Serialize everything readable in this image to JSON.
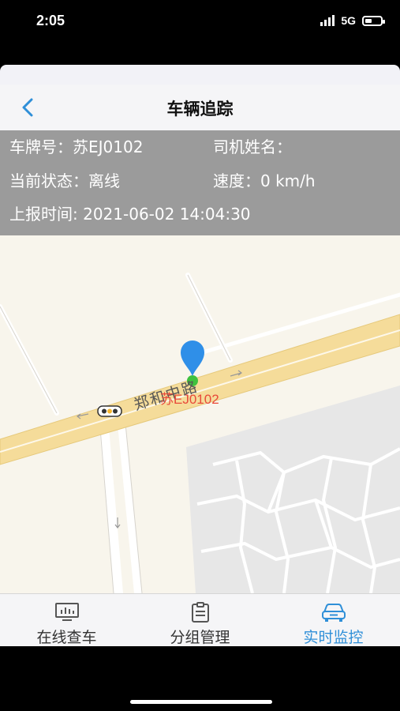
{
  "status": {
    "time": "2:05",
    "network": "5G",
    "icons": [
      "signal-icon",
      "battery-icon"
    ]
  },
  "nav": {
    "title": "车辆追踪",
    "back_icon": "chevron-left-icon"
  },
  "info": {
    "plate_label": "车牌号：",
    "plate_value": "苏EJ0102",
    "driver_label": "司机姓名：",
    "driver_value": "",
    "state_label": "当前状态：",
    "state_value": "离线",
    "speed_label": "速度：",
    "speed_value": "0 km/h",
    "report_label": "上报时间: ",
    "report_value": "2021-06-02 14:04:30"
  },
  "map": {
    "road_name": "郑和中路",
    "vehicle_plate": "苏EJ0102",
    "marker_icon": "location-pin-icon",
    "traffic_light_icon": "traffic-light-icon",
    "colors": {
      "background": "#f8f5ec",
      "main_road": "#f5dc9a",
      "block": "#e6e6e6",
      "marker": "#2f8fe8",
      "vehicle_dot": "#3ec13e",
      "label": "#e84a3a"
    }
  },
  "tabs": [
    {
      "label": "在线查车",
      "icon": "monitor-chart-icon",
      "active": false
    },
    {
      "label": "分组管理",
      "icon": "clipboard-icon",
      "active": false
    },
    {
      "label": "实时监控",
      "icon": "car-icon",
      "active": true
    }
  ],
  "colors": {
    "accent": "#2f8fd8",
    "info_bg": "#9b9b9b"
  }
}
